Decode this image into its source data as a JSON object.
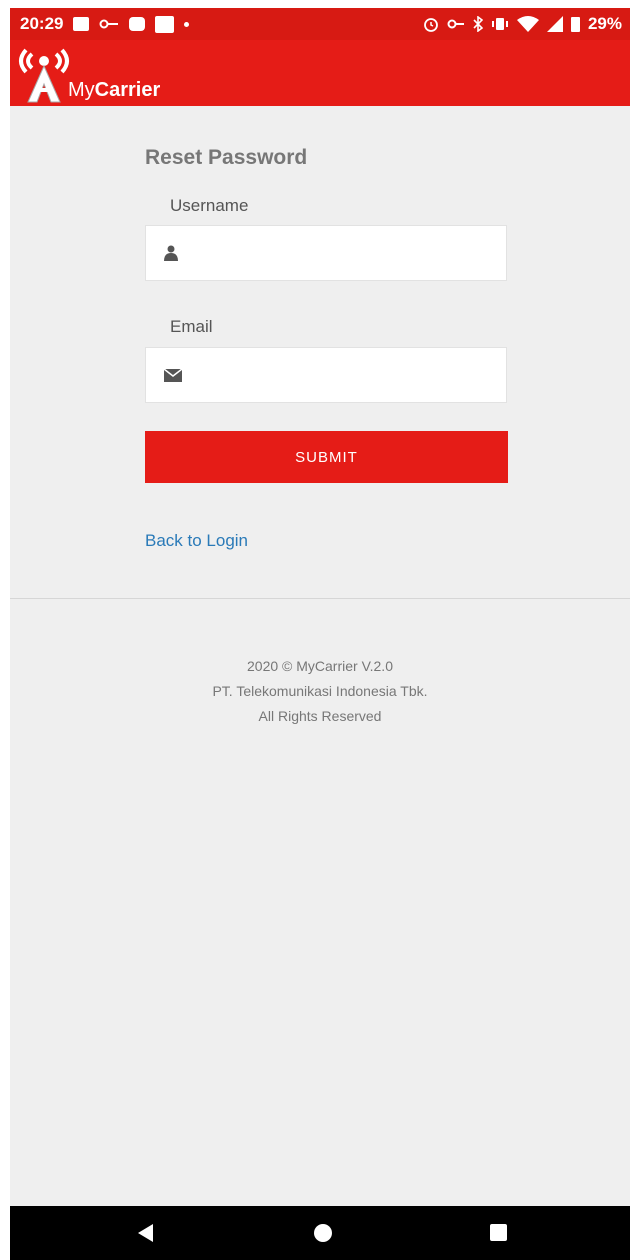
{
  "status_bar": {
    "time": "20:29",
    "battery": "29%",
    "left_icons": [
      "image-icon",
      "key-icon",
      "briefcase-icon",
      "news-icon",
      "dot-icon"
    ],
    "right_icons": [
      "alarm-icon",
      "vpn-key-icon",
      "bluetooth-icon",
      "vibrate-icon",
      "wifi-icon",
      "signal-icon",
      "battery-icon"
    ]
  },
  "app_bar": {
    "brand_prefix": "My",
    "brand_bold": "Carrier"
  },
  "form": {
    "title": "Reset Password",
    "username_label": "Username",
    "username_value": "",
    "email_label": "Email",
    "email_value": "",
    "submit_label": "SUBMIT",
    "back_link": "Back to Login"
  },
  "footer": {
    "line1": "2020 © MyCarrier V.2.0",
    "line2": "PT. Telekomunikasi Indonesia Tbk.",
    "line3": "All Rights Reserved"
  },
  "colors": {
    "primary": "#e51c17",
    "status_bar": "#d71a13",
    "link": "#2a7ab8",
    "background": "#efefef"
  },
  "nav_bar": {
    "icons": [
      "back-icon",
      "home-icon",
      "recents-icon"
    ]
  }
}
